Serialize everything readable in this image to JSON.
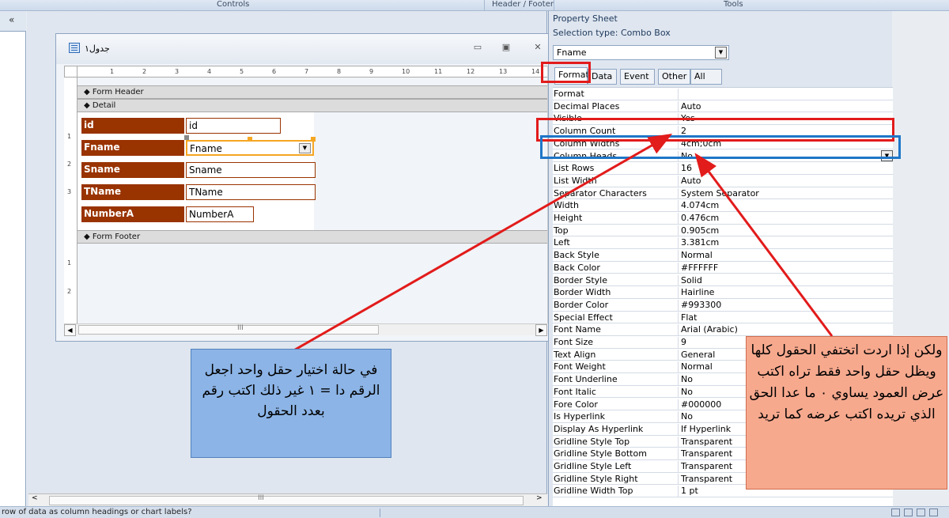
{
  "ribbon": {
    "controls": "Controls",
    "header_footer": "Header / Footer",
    "tools": "Tools"
  },
  "nav": {
    "collapse": "«"
  },
  "form_window": {
    "title": "جدول١",
    "min": "▭",
    "max": "▣",
    "close": "✕",
    "ruler_ticks": [
      "1",
      "2",
      "3",
      "4",
      "5",
      "6",
      "7",
      "8",
      "9",
      "10",
      "11",
      "12",
      "13",
      "14"
    ],
    "vruler_ticks": [
      "1",
      "2",
      "3",
      "1",
      "2"
    ],
    "sections": {
      "header": "◆ Form Header",
      "detail": "◆ Detail",
      "footer": "◆ Form Footer"
    },
    "fields": [
      {
        "label": "id",
        "control": "id"
      },
      {
        "label": "Fname",
        "control": "Fname"
      },
      {
        "label": "Sname",
        "control": "Sname"
      },
      {
        "label": "TName",
        "control": "TName"
      },
      {
        "label": "NumberA",
        "control": "NumberA"
      }
    ],
    "scroll_grip": "III",
    "scroll_up": "▲",
    "scroll_down": "▼",
    "scroll_left": "◀",
    "scroll_right": "▶"
  },
  "property_sheet": {
    "title": "Property Sheet",
    "selection_type": "Selection type:  Combo Box",
    "selected_object": "Fname",
    "dropdown_arrow": "▼",
    "tabs": [
      "Format",
      "Data",
      "Event",
      "Other",
      "All"
    ],
    "rows": [
      {
        "name": "Format",
        "value": ""
      },
      {
        "name": "Decimal Places",
        "value": "Auto"
      },
      {
        "name": "Visible",
        "value": "Yes"
      },
      {
        "name": "Column Count",
        "value": "2"
      },
      {
        "name": "Column Widths",
        "value": "4cm;0cm"
      },
      {
        "name": "Column Heads",
        "value": "No"
      },
      {
        "name": "List Rows",
        "value": "16"
      },
      {
        "name": "List Width",
        "value": "Auto"
      },
      {
        "name": "Separator Characters",
        "value": "System Separator"
      },
      {
        "name": "Width",
        "value": "4.074cm"
      },
      {
        "name": "Height",
        "value": "0.476cm"
      },
      {
        "name": "Top",
        "value": "0.905cm"
      },
      {
        "name": "Left",
        "value": "3.381cm"
      },
      {
        "name": "Back Style",
        "value": "Normal"
      },
      {
        "name": "Back Color",
        "value": "#FFFFFF"
      },
      {
        "name": "Border Style",
        "value": "Solid"
      },
      {
        "name": "Border Width",
        "value": "Hairline"
      },
      {
        "name": "Border Color",
        "value": "#993300"
      },
      {
        "name": "Special Effect",
        "value": "Flat"
      },
      {
        "name": "Font Name",
        "value": "Arial (Arabic)"
      },
      {
        "name": "Font Size",
        "value": "9"
      },
      {
        "name": "Text Align",
        "value": "General"
      },
      {
        "name": "Font Weight",
        "value": "Normal"
      },
      {
        "name": "Font Underline",
        "value": "No"
      },
      {
        "name": "Font Italic",
        "value": "No"
      },
      {
        "name": "Fore Color",
        "value": "#000000"
      },
      {
        "name": "Is Hyperlink",
        "value": "No"
      },
      {
        "name": "Display As Hyperlink",
        "value": "If Hyperlink"
      },
      {
        "name": "Gridline Style Top",
        "value": "Transparent"
      },
      {
        "name": "Gridline Style Bottom",
        "value": "Transparent"
      },
      {
        "name": "Gridline Style Left",
        "value": "Transparent"
      },
      {
        "name": "Gridline Style Right",
        "value": "Transparent"
      },
      {
        "name": "Gridline Width Top",
        "value": "1 pt"
      }
    ]
  },
  "status_bar": {
    "text": "row of data as column headings or chart labels?"
  },
  "annotations": {
    "left_note": "في حالة اختيار حقل واحد اجعل الرقم دا = ١ غير ذلك اكتب رقم بعدد الحقول",
    "right_note": "ولكن إذا اردت اتختفي الحقول كلها ويظل حقل واحد فقط تراه اكتب عرض العمود يساوي ٠ ما عدا الحق الذي تريده اكتب عرضه كما تريد"
  },
  "colors": {
    "label_bg": "#993300",
    "highlight_red": "#e21b1b",
    "highlight_blue": "#1f76c8",
    "note_left_bg": "#8cb4e6",
    "note_right_bg": "#f7a98e"
  }
}
